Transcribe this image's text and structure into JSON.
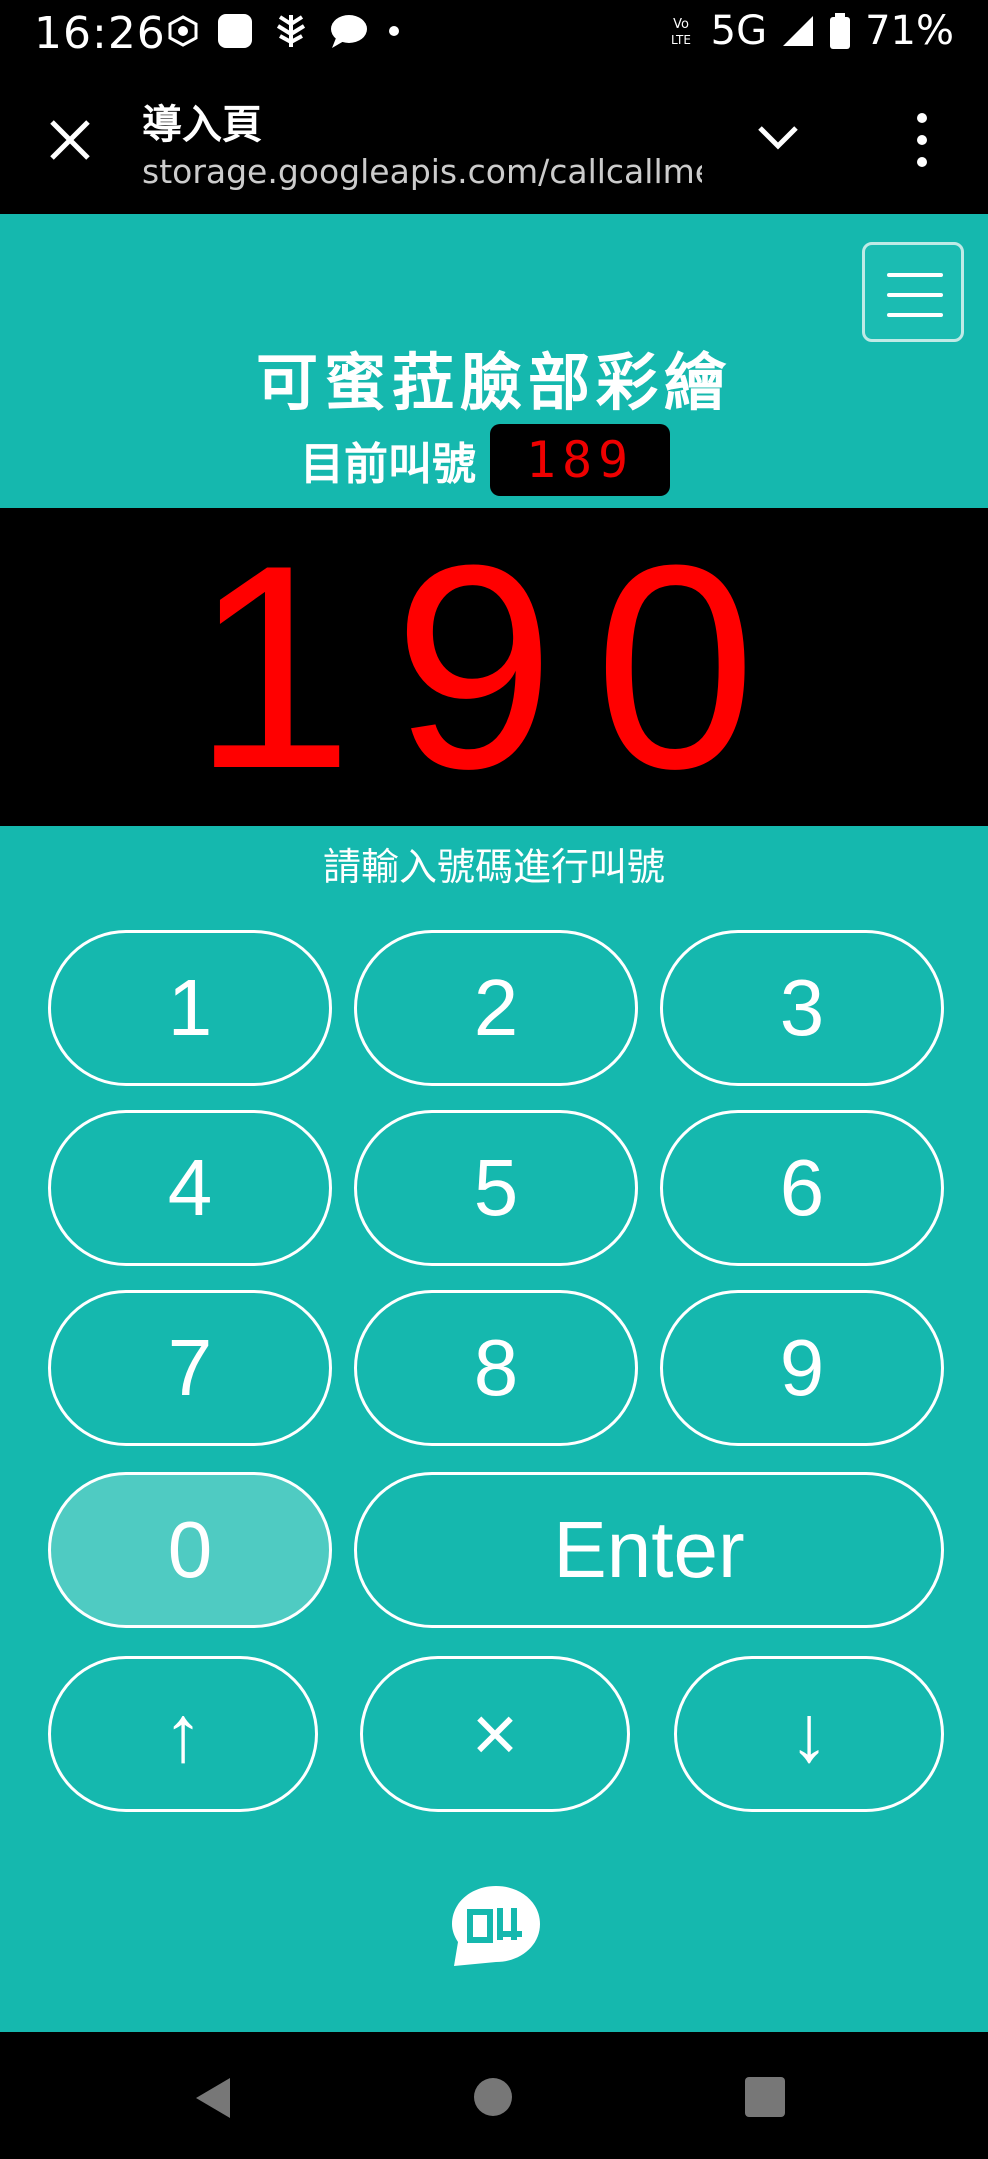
{
  "status_bar": {
    "time": "16:26",
    "network": "5G",
    "battery": "71%",
    "icons": [
      "vpn-icon",
      "app-icon",
      "leaf-icon",
      "chat-icon",
      "dot-icon",
      "volte-icon",
      "signal-icon",
      "battery-icon"
    ]
  },
  "browser": {
    "title": "導入頁",
    "url": "storage.googleapis.com/callcallme/c"
  },
  "header": {
    "shop_name": "可蜜菈臉部彩繪",
    "current_label": "目前叫號",
    "current_number": "189"
  },
  "display": {
    "big_number": "190"
  },
  "keypad": {
    "hint": "請輸入號碼進行叫號",
    "k1": "1",
    "k2": "2",
    "k3": "3",
    "k4": "4",
    "k5": "5",
    "k6": "6",
    "k7": "7",
    "k8": "8",
    "k9": "9",
    "k0": "0",
    "enter": "Enter",
    "up": "↑",
    "clear": "×",
    "down": "↓"
  },
  "colors": {
    "background": "#15b8ae",
    "number_red": "#ff0000",
    "active_key": "#4fcbc2"
  }
}
